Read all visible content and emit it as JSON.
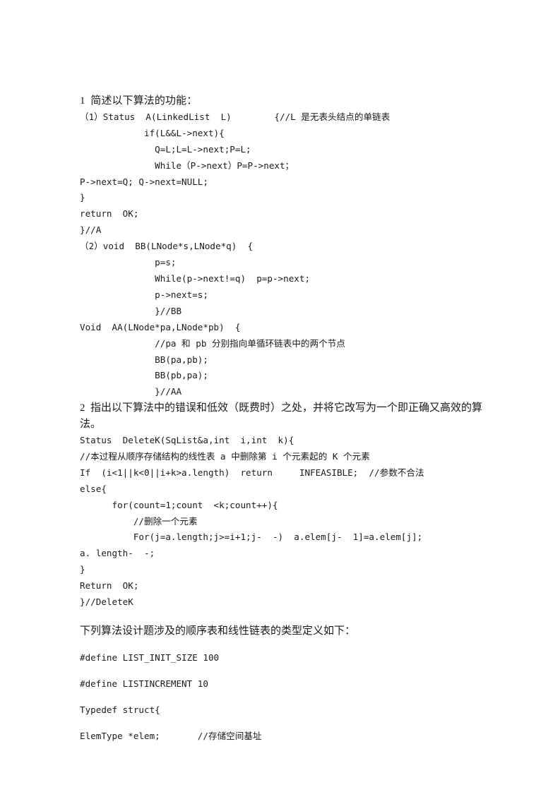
{
  "document": {
    "page_number": 1,
    "language": "zh-CN",
    "text_color": "#1a1a1a",
    "background_color": "#ffffff"
  },
  "section1": {
    "heading": "1  简述以下算法的功能：",
    "lines": [
      "（1）Status  A(LinkedList  L)        {//L 是无表头结点的单链表",
      "            if(L&&L->next){",
      "              Q=L;L=L->next;P=L;",
      "              While（P->next）P=P->next；",
      "P->next=Q; Q->next=NULL;",
      "}",
      "return  OK;",
      "}//A",
      "（2）void  BB(LNode*s,LNode*q)  {",
      "              p=s;",
      "              While(p->next!=q)  p=p->next;",
      "              p->next=s;",
      "              }//BB",
      "Void  AA(LNode*pa,LNode*pb)  {",
      "              //pa 和 pb 分别指向单循环链表中的两个节点",
      "              BB(pa,pb);",
      "              BB(pb,pa);",
      "              }//AA"
    ]
  },
  "section2": {
    "heading": "2  指出以下算法中的错误和低效（既费时）之处，并将它改写为一个即正确又高效的算法。",
    "lines": [
      "Status  DeleteK(SqList&a,int  i,int  k){",
      "//本过程从顺序存储结构的线性表 a 中删除第 i 个元素起的 K 个元素",
      "If  (i<1||k<0||i+k>a.length)  return     INFEASIBLE;  //参数不合法",
      "else{",
      "      for(count=1;count  <k;count++){",
      "          //删除一个元素",
      "          For(j=a.length;j>=i+1;j-  -)  a.elem[j-  1]=a.elem[j];",
      "a. length-  -;",
      "}",
      "Return  OK;",
      "}//DeleteK"
    ]
  },
  "section3": {
    "intro": "下列算法设计题涉及的顺序表和线性链表的类型定义如下：",
    "lines": [
      "#define LIST_INIT_SIZE 100",
      "#define LISTINCREMENT 10",
      "Typedef struct{",
      "ElemType *elem;       //存储空间基址"
    ]
  }
}
